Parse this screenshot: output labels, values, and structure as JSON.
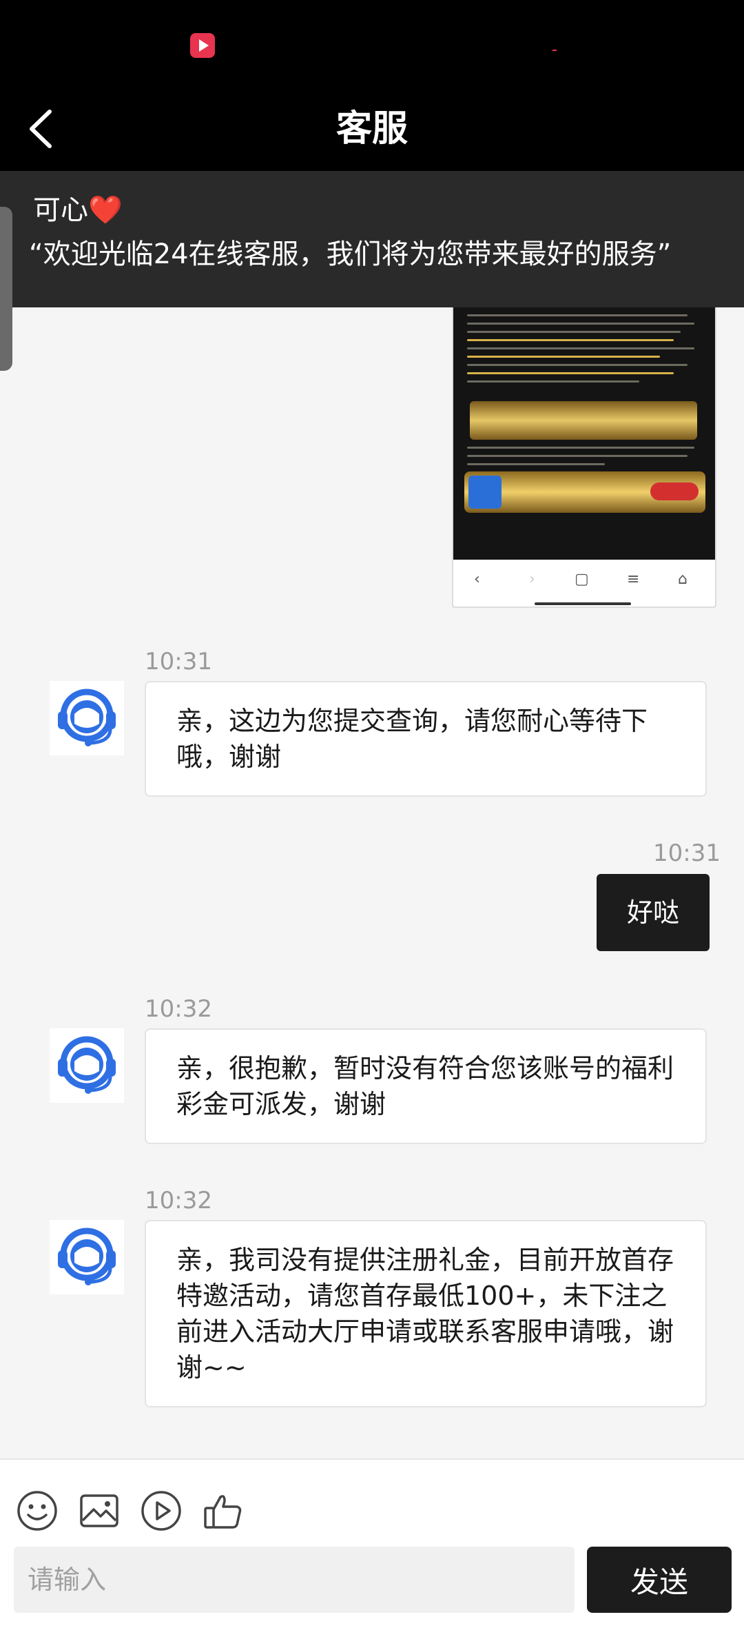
{
  "nav": {
    "title": "客服"
  },
  "notice": {
    "name": "可心❤️",
    "text": "“欢迎光临24在线客服，我们将为您带来最好的服务”"
  },
  "messages": [
    {
      "time": "10:31",
      "side": "left",
      "text": "亲，这边为您提交查询，请您耐心等待下哦，谢谢"
    },
    {
      "time": "10:31",
      "side": "right",
      "text": "好哒"
    },
    {
      "time": "10:32",
      "side": "left",
      "text": "亲，很抱歉，暂时没有符合您该账号的福利彩金可派发，谢谢"
    },
    {
      "time": "10:32",
      "side": "left",
      "text": "亲，我司没有提供注册礼金，目前开放首存特邀活动，请您首存最低100+，未下注之前进入活动大厅申请或联系客服申请哦，谢谢~~"
    }
  ],
  "composer": {
    "placeholder": "请输入",
    "send_label": "发送"
  },
  "colors": {
    "accent": "#1c1c1c",
    "avatar_blue": "#2f6fe4",
    "brand_red": "#e8344f"
  }
}
